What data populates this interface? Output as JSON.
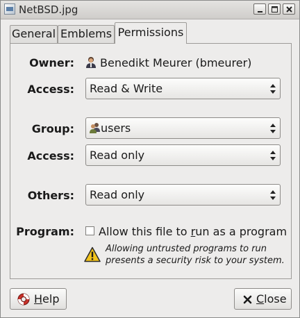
{
  "window": {
    "title": "NetBSD.jpg",
    "controls": [
      "minimize-icon",
      "maximize-icon",
      "close-icon"
    ]
  },
  "tabs": [
    {
      "label": "General",
      "active": false
    },
    {
      "label": "Emblems",
      "active": false
    },
    {
      "label": "Permissions",
      "active": true
    }
  ],
  "permissions": {
    "owner_label": "Owner:",
    "owner_value": "Benedikt Meurer (bmeurer)",
    "owner_access_label": "Access:",
    "owner_access_value": "Read & Write",
    "group_label": "Group:",
    "group_value": "users",
    "group_access_label": "Access:",
    "group_access_value": "Read only",
    "others_label": "Others:",
    "others_value": "Read only",
    "program_label": "Program:",
    "program_checkbox_prefix": "Allow this file to ",
    "program_checkbox_mnemonic": "r",
    "program_checkbox_suffix": "un as a program",
    "program_checked": false,
    "warning_line1": "Allowing untrusted programs to run",
    "warning_line2": "presents a security risk to your system."
  },
  "buttons": {
    "help": {
      "mnemonic": "H",
      "rest": "elp",
      "icon": "lifebuoy-icon"
    },
    "close": {
      "mnemonic": "C",
      "rest": "lose",
      "icon": "close-x-icon"
    }
  },
  "icons": {
    "owner": "user-icon",
    "group": "group-icon",
    "warning": "warning-icon"
  },
  "colors": {
    "background": "#edeceb",
    "warning_fill": "#f2c31b",
    "help_icon": "#c8322b"
  }
}
